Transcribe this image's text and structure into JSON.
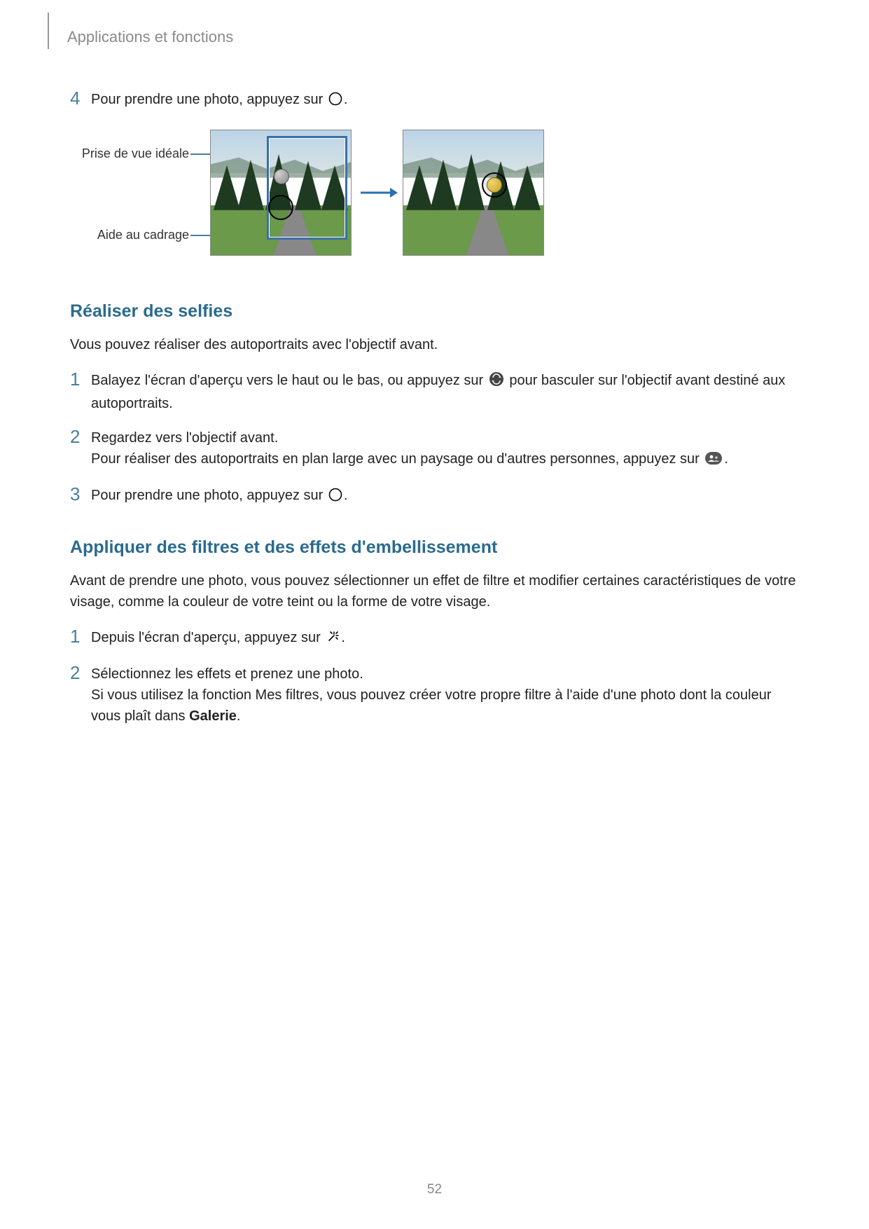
{
  "header": {
    "title": "Applications et fonctions"
  },
  "step4": {
    "num": "4",
    "text_before": "Pour prendre une photo, appuyez sur ",
    "text_after": "."
  },
  "figure": {
    "label_ideal": "Prise de vue idéale",
    "label_guide": "Aide au cadrage"
  },
  "section_selfies": {
    "heading": "Réaliser des selfies",
    "intro": "Vous pouvez réaliser des autoportraits avec l'objectif avant.",
    "step1": {
      "num": "1",
      "before": "Balayez l'écran d'aperçu vers le haut ou le bas, ou appuyez sur ",
      "after": " pour basculer sur l'objectif avant destiné aux autoportraits."
    },
    "step2": {
      "num": "2",
      "line1": "Regardez vers l'objectif avant.",
      "line2_before": "Pour réaliser des autoportraits en plan large avec un paysage ou d'autres personnes, appuyez sur ",
      "line2_after": "."
    },
    "step3": {
      "num": "3",
      "before": "Pour prendre une photo, appuyez sur ",
      "after": "."
    }
  },
  "section_filters": {
    "heading": "Appliquer des filtres et des effets d'embellissement",
    "intro": "Avant de prendre une photo, vous pouvez sélectionner un effet de filtre et modifier certaines caractéristiques de votre visage, comme la couleur de votre teint ou la forme de votre visage.",
    "step1": {
      "num": "1",
      "before": "Depuis l'écran d'aperçu, appuyez sur ",
      "after": "."
    },
    "step2": {
      "num": "2",
      "line1": "Sélectionnez les effets et prenez une photo.",
      "line2_before": "Si vous utilisez la fonction Mes filtres, vous pouvez créer votre propre filtre à l'aide d'une photo dont la couleur vous plaît dans ",
      "bold": "Galerie",
      "line2_after": "."
    }
  },
  "page_number": "52"
}
